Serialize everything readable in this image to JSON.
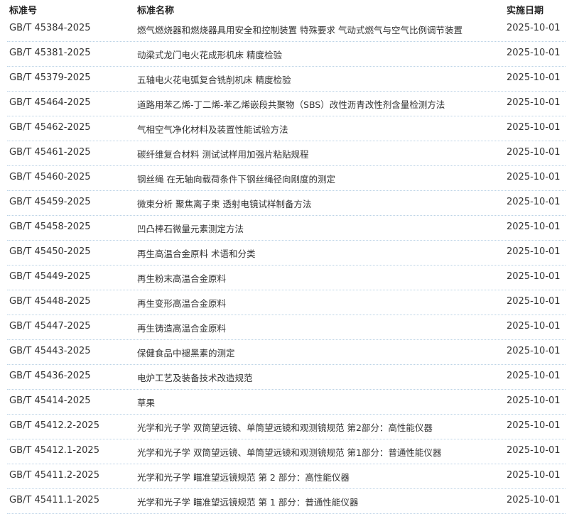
{
  "table": {
    "headers": {
      "code": "标准号",
      "name": "标准名称",
      "date": "实施日期"
    },
    "rows": [
      {
        "code": "GB/T 45384-2025",
        "name": "燃气燃烧器和燃烧器具用安全和控制装置 特殊要求 气动式燃气与空气比例调节装置",
        "date": "2025-10-01"
      },
      {
        "code": "GB/T 45381-2025",
        "name": "动梁式龙门电火花成形机床 精度检验",
        "date": "2025-10-01"
      },
      {
        "code": "GB/T 45379-2025",
        "name": "五轴电火花电弧复合铣削机床 精度检验",
        "date": "2025-10-01"
      },
      {
        "code": "GB/T 45464-2025",
        "name": "道路用苯乙烯-丁二烯-苯乙烯嵌段共聚物（SBS）改性沥青改性剂含量检测方法",
        "date": "2025-10-01"
      },
      {
        "code": "GB/T 45462-2025",
        "name": "气相空气净化材料及装置性能试验方法",
        "date": "2025-10-01"
      },
      {
        "code": "GB/T 45461-2025",
        "name": "碳纤维复合材料 测试试样用加强片粘贴规程",
        "date": "2025-10-01"
      },
      {
        "code": "GB/T 45460-2025",
        "name": "钢丝绳 在无轴向载荷条件下钢丝绳径向刚度的测定",
        "date": "2025-10-01"
      },
      {
        "code": "GB/T 45459-2025",
        "name": "微束分析 聚焦离子束 透射电镜试样制备方法",
        "date": "2025-10-01"
      },
      {
        "code": "GB/T 45458-2025",
        "name": "凹凸棒石微量元素测定方法",
        "date": "2025-10-01"
      },
      {
        "code": "GB/T 45450-2025",
        "name": "再生高温合金原料 术语和分类",
        "date": "2025-10-01"
      },
      {
        "code": "GB/T 45449-2025",
        "name": "再生粉末高温合金原料",
        "date": "2025-10-01"
      },
      {
        "code": "GB/T 45448-2025",
        "name": "再生变形高温合金原料",
        "date": "2025-10-01"
      },
      {
        "code": "GB/T 45447-2025",
        "name": "再生铸造高温合金原料",
        "date": "2025-10-01"
      },
      {
        "code": "GB/T 45443-2025",
        "name": "保健食品中褪黑素的测定",
        "date": "2025-10-01"
      },
      {
        "code": "GB/T 45436-2025",
        "name": "电炉工艺及装备技术改造规范",
        "date": "2025-10-01"
      },
      {
        "code": "GB/T 45414-2025",
        "name": "草果",
        "date": "2025-10-01"
      },
      {
        "code": "GB/T 45412.2-2025",
        "name": "光学和光子学 双筒望远镜、单筒望远镜和观测镜规范 第2部分：高性能仪器",
        "date": "2025-10-01"
      },
      {
        "code": "GB/T 45412.1-2025",
        "name": "光学和光子学 双筒望远镜、单筒望远镜和观测镜规范 第1部分：普通性能仪器",
        "date": "2025-10-01"
      },
      {
        "code": "GB/T 45411.2-2025",
        "name": "光学和光子学 瞄准望远镜规范 第 2 部分：高性能仪器",
        "date": "2025-10-01"
      },
      {
        "code": "GB/T 45411.1-2025",
        "name": "光学和光子学 瞄准望远镜规范 第 1 部分：普通性能仪器",
        "date": "2025-10-01"
      }
    ]
  }
}
